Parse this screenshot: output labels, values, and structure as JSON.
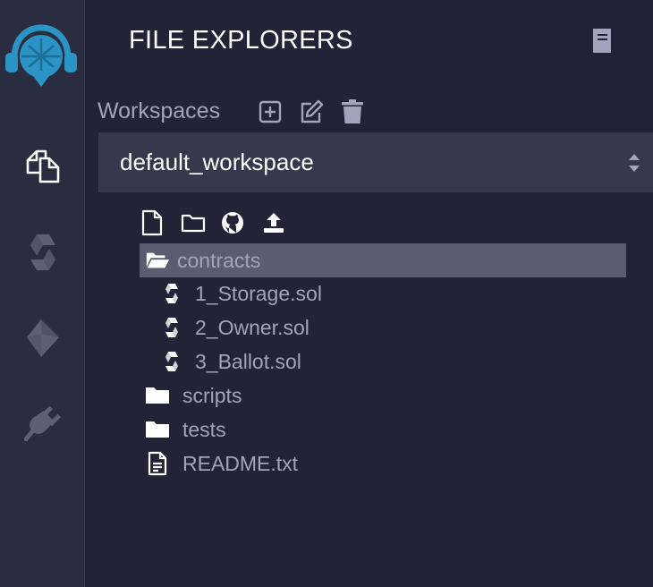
{
  "colors": {
    "background": "#222336",
    "iconbar": "#2a2c3f",
    "select_bg": "#36384c",
    "selected_row": "#5b5c72",
    "muted_text": "#a2a3bd",
    "logo_blue": "#2c93c5"
  },
  "iconbar": {
    "logo": "remix-logo",
    "items": [
      {
        "name": "file-explorers-icon"
      },
      {
        "name": "solidity-compiler-icon"
      },
      {
        "name": "deploy-run-icon"
      },
      {
        "name": "plugin-manager-icon"
      }
    ]
  },
  "panel": {
    "title": "FILE EXPLORERS",
    "docs_icon": "book-icon"
  },
  "workspaces": {
    "label": "Workspaces",
    "actions": [
      "create-workspace-icon",
      "rename-workspace-icon",
      "delete-workspace-icon"
    ],
    "selected": "default_workspace"
  },
  "file_explorer": {
    "toolbar": [
      "new-file-icon",
      "new-folder-icon",
      "github-icon",
      "upload-icon"
    ],
    "tree": [
      {
        "label": "contracts",
        "type": "folder-open",
        "selected": true
      },
      {
        "label": "1_Storage.sol",
        "type": "solidity-file"
      },
      {
        "label": "2_Owner.sol",
        "type": "solidity-file"
      },
      {
        "label": "3_Ballot.sol",
        "type": "solidity-file"
      },
      {
        "label": "scripts",
        "type": "folder"
      },
      {
        "label": "tests",
        "type": "folder"
      },
      {
        "label": "README.txt",
        "type": "text-file"
      }
    ]
  }
}
